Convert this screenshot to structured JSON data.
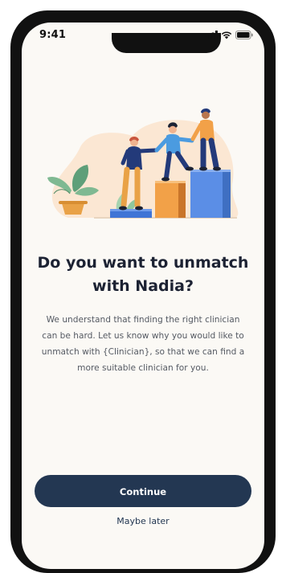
{
  "status_bar": {
    "time": "9:41",
    "icons": [
      "cellular-signal-icon",
      "wifi-icon",
      "battery-icon"
    ]
  },
  "illustration": {
    "name": "people-helping-each-other-climb-steps-illustration"
  },
  "dialog": {
    "title": "Do you want to unmatch with Nadia?",
    "body": "We understand that finding the right clinician can be hard. Let us know why you would like to unmatch with {Clinician}, so that we can find a more suitable clinician for you.",
    "primary_button": "Continue",
    "secondary_link": "Maybe later"
  },
  "colors": {
    "background": "#fbf9f5",
    "primary": "#233752",
    "title_text": "#1c2233",
    "body_text": "#555a63"
  }
}
